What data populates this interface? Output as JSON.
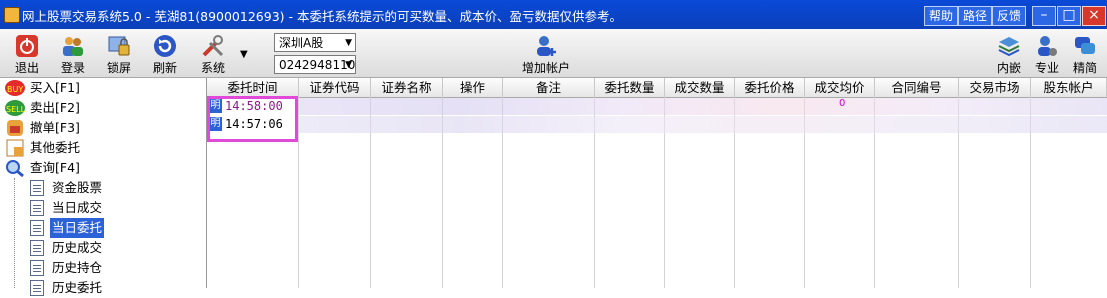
{
  "title": {
    "text": "网上股票交易系统5.0 - 芜湖81(8900012693) - 本委托系统提示的可买数量、成本价、盈亏数据仅供参考。",
    "buttons": [
      "帮助",
      "路径",
      "反馈"
    ]
  },
  "toolbar": {
    "buttons": [
      {
        "label": "退出",
        "icon": "power-icon"
      },
      {
        "label": "登录",
        "icon": "users-icon"
      },
      {
        "label": "锁屏",
        "icon": "lock-screen-icon"
      },
      {
        "label": "刷新",
        "icon": "refresh-icon"
      },
      {
        "label": "系统",
        "icon": "tools-icon"
      }
    ],
    "market_select": "深圳A股",
    "account_select": "0242948110",
    "add_account": "增加帐户",
    "right_buttons": [
      {
        "label": "内嵌",
        "icon": "layers-icon"
      },
      {
        "label": "专业",
        "icon": "user-gear-icon"
      },
      {
        "label": "精简",
        "icon": "chat-icon"
      }
    ]
  },
  "sidebar": {
    "items": [
      {
        "label": "买入[F1]",
        "icon": "buy-icon"
      },
      {
        "label": "卖出[F2]",
        "icon": "sell-icon"
      },
      {
        "label": "撤单[F3]",
        "icon": "cancel-hand-icon"
      },
      {
        "label": "其他委托",
        "icon": "other-order-icon"
      },
      {
        "label": "查询[F4]",
        "icon": "query-search-icon"
      }
    ],
    "query_children": [
      "资金股票",
      "当日成交",
      "当日委托",
      "历史成交",
      "历史持仓",
      "历史委托"
    ],
    "selected": "当日委托"
  },
  "grid": {
    "columns": [
      "委托时间",
      "证券代码",
      "证券名称",
      "操作",
      "备注",
      "委托数量",
      "成交数量",
      "委托价格",
      "成交均价",
      "合同编号",
      "交易市场",
      "股东帐户"
    ],
    "rows": [
      {
        "badge": "明",
        "time": "14:58:00"
      },
      {
        "badge": "明",
        "time": "14:57:06"
      }
    ],
    "stray_value": "0"
  },
  "colors": {
    "titlebar": "#0b44c8",
    "selected": "#2b62d8",
    "highlight_box": "#e04ad8"
  }
}
